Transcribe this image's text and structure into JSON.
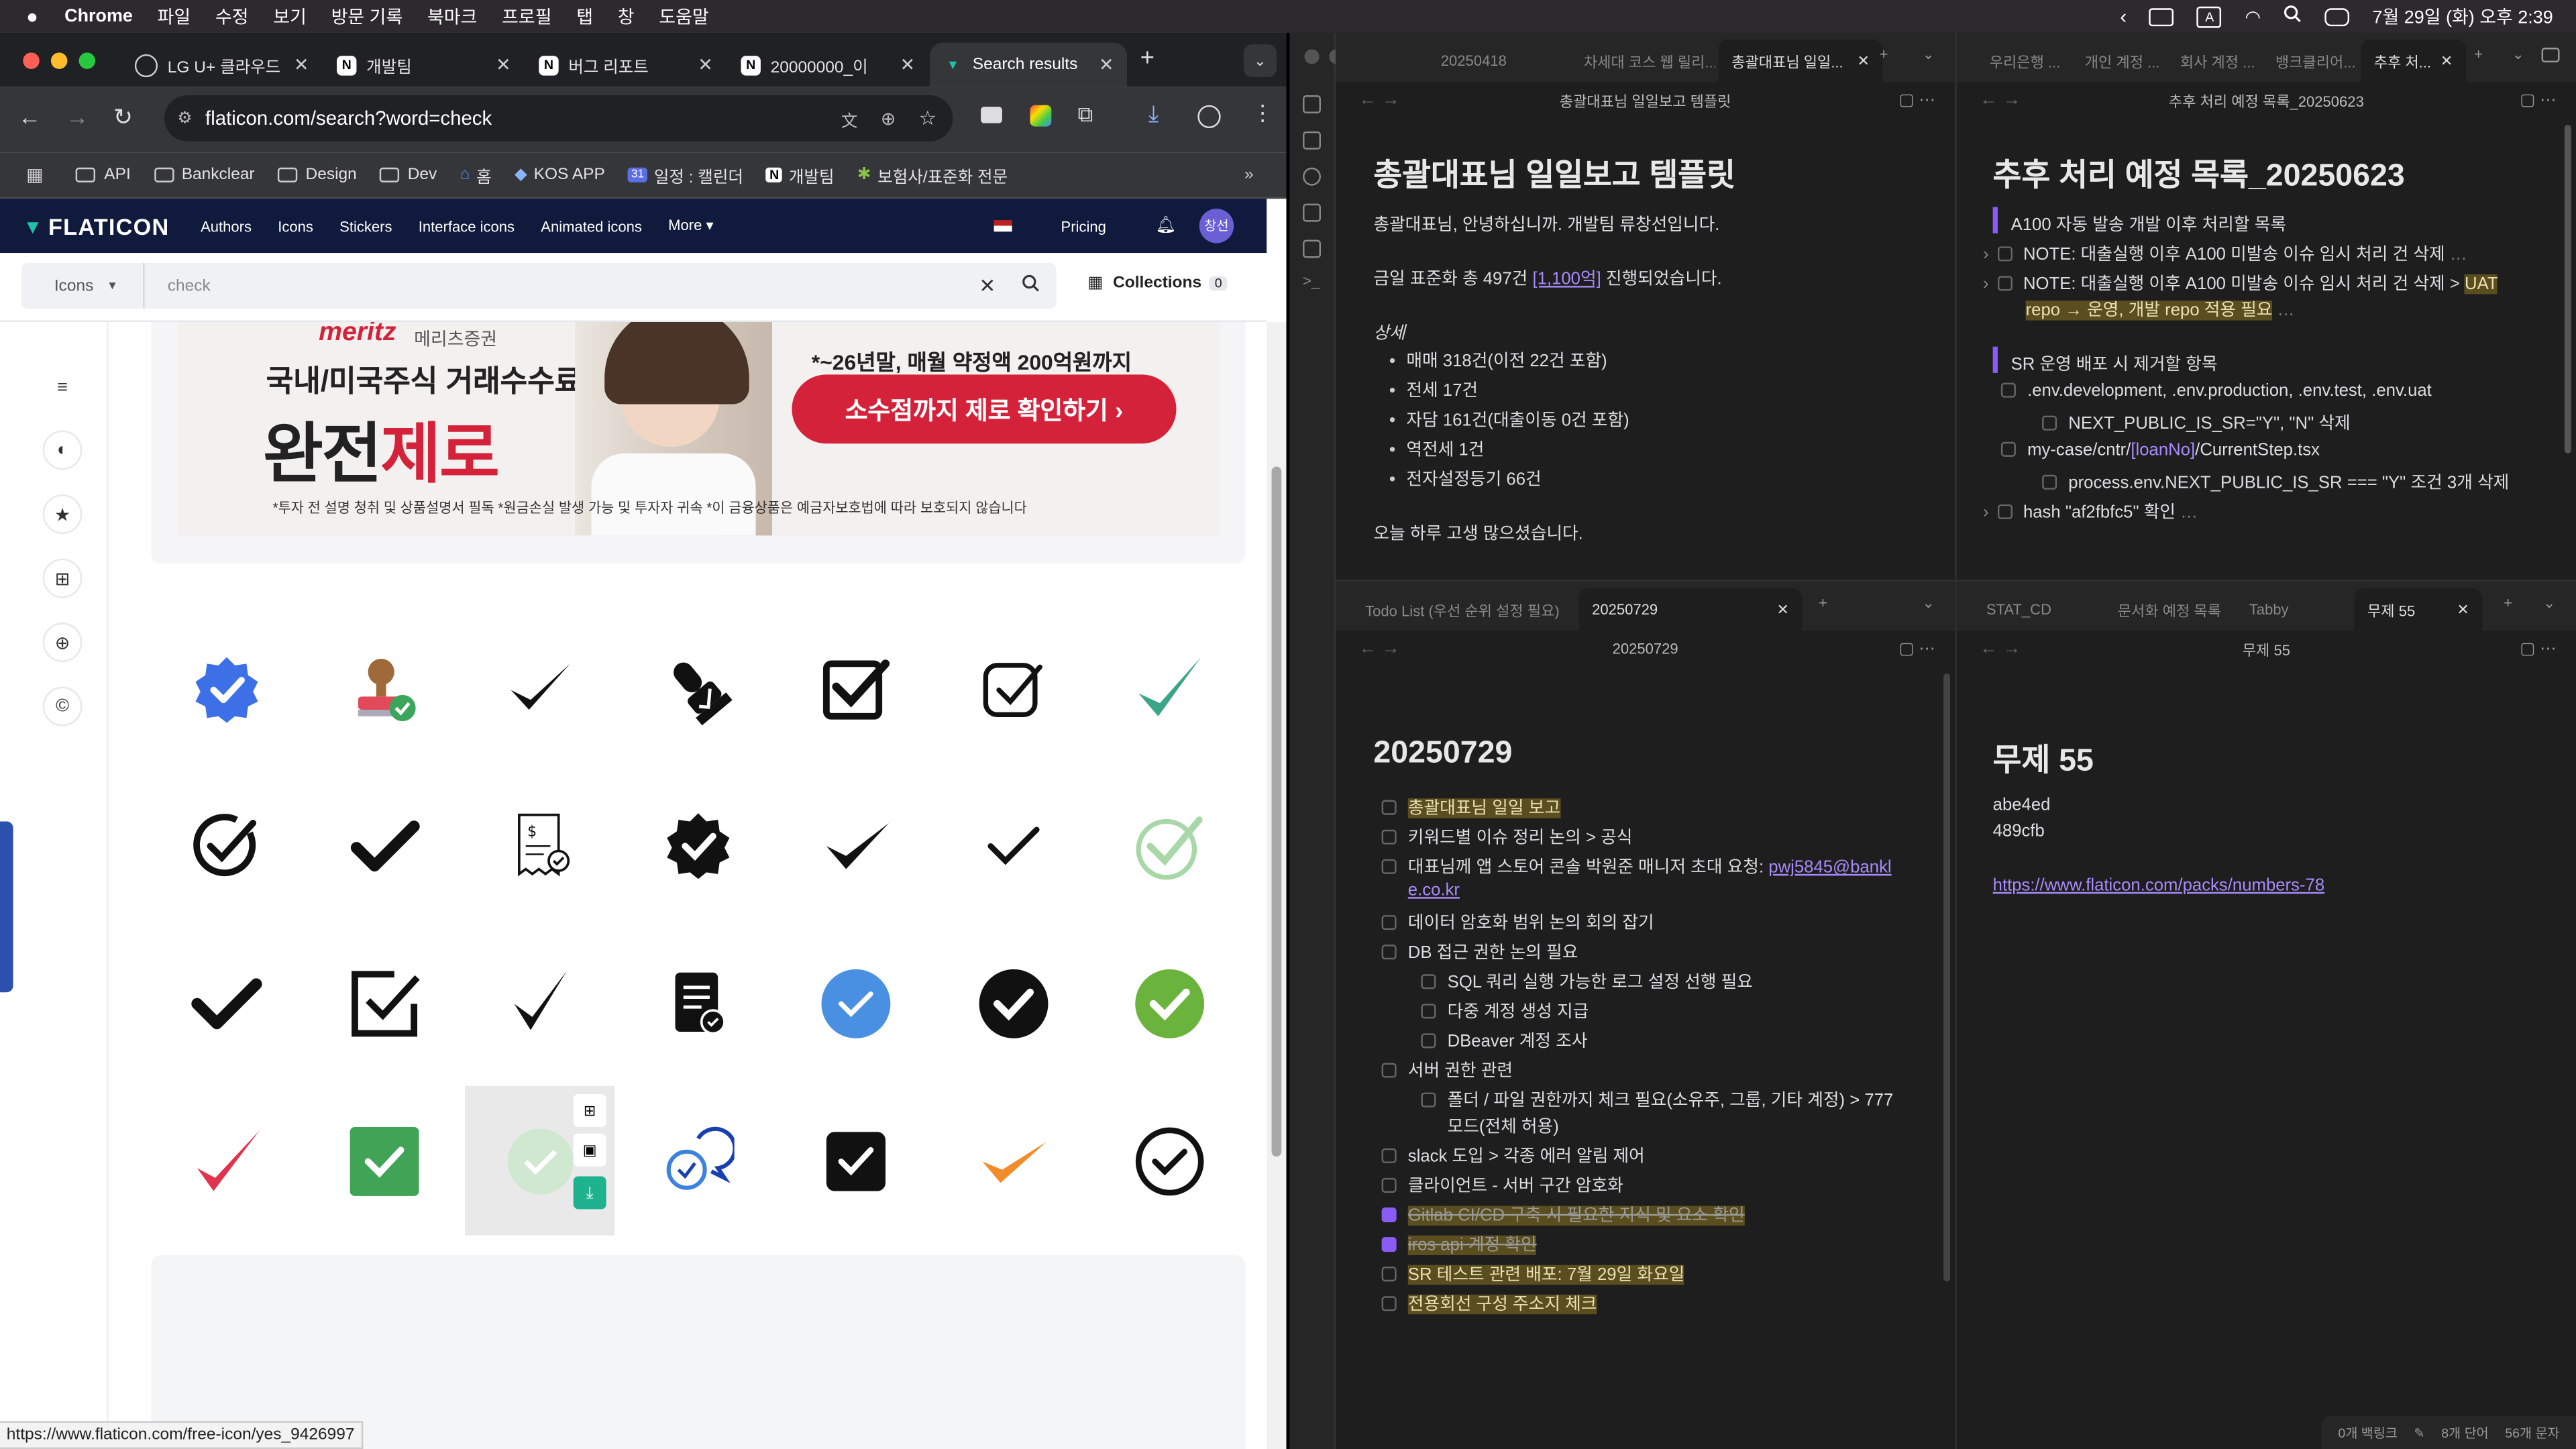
{
  "menubar": {
    "app": "Chrome",
    "items": [
      "파일",
      "수정",
      "보기",
      "방문 기록",
      "북마크",
      "프로필",
      "탭",
      "창",
      "도움말"
    ],
    "clock": "7월 29일 (화) 오후 2:39"
  },
  "browser": {
    "tabs": [
      {
        "label": "LG U+ 클라우드"
      },
      {
        "label": "개발팀"
      },
      {
        "label": "버그 리포트"
      },
      {
        "label": "20000000_이"
      },
      {
        "label": "Search results"
      }
    ],
    "url": "flaticon.com/search?word=check",
    "bookmarks": [
      "API",
      "Bankclear",
      "Design",
      "Dev",
      "홈",
      "KOS APP",
      "일정 : 캘린더",
      "개발팀",
      "보험사/표준화 전문"
    ],
    "status_url": "https://www.flaticon.com/free-icon/yes_9426997"
  },
  "flaticon": {
    "logo": "FLATICON",
    "nav": [
      "Authors",
      "Icons",
      "Stickers",
      "Interface icons",
      "Animated icons",
      "More"
    ],
    "pricing": "Pricing",
    "avatar": "창선",
    "search_type": "Icons",
    "search_value": "check",
    "collections_label": "Collections",
    "collections_count": "0",
    "ad": {
      "brand": "meritz",
      "brand_sub": "메리츠증권",
      "line1": "국내/미국주식 거래수수료",
      "line2a": "완전",
      "line2b": "제로",
      "promo": "*~26년말, 매월 약정액 200억원까지",
      "cta": "소수점까지 제로 확인하기 ›",
      "disclaimer": "*투자 전 설명 청취 및 상품설명서 필독 *원금손실 발생 가능 및 투자자 귀속 *이 금융상품은 예금자보호법에 따라 보호되지 않습니다"
    }
  },
  "obsidian": {
    "pane1": {
      "tabs": [
        "20250418",
        "차세대 코스 웹 릴리...",
        "총괄대표님 일일..."
      ],
      "header": "총괄대표님 일일보고 템플릿",
      "title": "총괄대표님 일일보고 템플릿",
      "greet": "총괄대표님, 안녕하십니까. 개발팀 류창선입니다.",
      "summary_a": "금일 표준화 총 497건 ",
      "summary_link": "[1,100억]",
      "summary_b": " 진행되었습니다.",
      "detail_heading": "상세",
      "details": [
        "매매 318건(이전 22건 포함)",
        "전세 17건",
        "자담 161건(대출이동 0건 포함)",
        "역전세 1건",
        "전자설정등기 66건"
      ],
      "closing": "오늘 하루 고생 많으셨습니다."
    },
    "pane2": {
      "tabs": [
        "우리은행 ...",
        "개인 계정 ...",
        "회사 계정 ...",
        "뱅크클리어...",
        "추후 처..."
      ],
      "header": "추후 처리 예정 목록_20250623",
      "title": "추후 처리 예정 목록_20250623",
      "sec1": "A100 자동 발송 개발 이후 처리할 목록",
      "n1": "NOTE: 대출실행 이후 A100 미발송 이슈 임시 처리 건 삭제",
      "n2a": "NOTE: 대출실행 이후 A100 미발송 이슈 임시 처리 건 삭제 > ",
      "n2b": "UAT",
      "n2c": "repo → 운영, 개발 repo 적용 필요",
      "sec2": "SR 운영 배포 시 제거할 항목",
      "e1": ".env.development, .env.production, .env.test, .env.uat",
      "e1s": "NEXT_PUBLIC_IS_SR=\"Y\", \"N\" 삭제",
      "e2a": "my-case/cntr/",
      "e2b": "[loanNo]",
      "e2c": "/CurrentStep.tsx",
      "e2s": "process.env.NEXT_PUBLIC_IS_SR === \"Y\" 조건 3개 삭제",
      "e3": "hash \"af2fbfc5\" 확인"
    },
    "pane3": {
      "tabs": [
        "Todo List (우선 순위 설정 필요)",
        "20250729"
      ],
      "header": "20250729",
      "title": "20250729",
      "items": [
        {
          "t": "총괄대표님 일일 보고",
          "hl": true
        },
        {
          "t": "키워드별 이슈 정리 논의 > 공식"
        },
        {
          "t": "대표님께 앱 스토어 콘솔 박원준 매니저 초대 요청: ",
          "link1": "pwj5845@bankl",
          "link2": "e.co.kr"
        },
        {
          "t": "데이터 암호화 범위 논의 회의 잡기"
        },
        {
          "t": "DB 접근 권한 논의 필요"
        },
        {
          "t": "SQL 쿼리 실행 가능한 로그 설정 선행 필요",
          "sub": true
        },
        {
          "t": "다중 계정 생성 지급",
          "sub": true
        },
        {
          "t": "DBeaver 계정 조사",
          "sub": true
        },
        {
          "t": "서버 권한 관련"
        },
        {
          "t": "폴더 / 파일 권한까지 체크 필요(소유주, 그룹, 기타 계정) > 777",
          "t2": "모드(전체 허용)",
          "sub": true
        },
        {
          "t": "slack 도입 > 각종 에러 알림 제어"
        },
        {
          "t": "클라이언트 - 서버 구간 암호화"
        },
        {
          "t": "Gitlab CI/CD 구축 시 필요한 지식 및 요소 확인",
          "done": true,
          "hl": true
        },
        {
          "t": "iros api 계정 확인",
          "done": true,
          "hl": true
        },
        {
          "t": "SR 테스트 관련 배포: 7월 29일 화요일",
          "hl": true
        },
        {
          "t": "전용회선 구성 주소지 체크",
          "hl": true
        }
      ]
    },
    "pane4": {
      "tabs": [
        "STAT_CD",
        "문서화 예정 목록",
        "Tabby",
        "무제 55"
      ],
      "header": "무제 55",
      "title": "무제 55",
      "l1": "abe4ed",
      "l2": "489cfb",
      "link": "https://www.flaticon.com/packs/numbers-78"
    },
    "statusbar": {
      "backlinks": "0개 백링크",
      "words": "8개 단어",
      "chars": "56개 문자"
    }
  }
}
